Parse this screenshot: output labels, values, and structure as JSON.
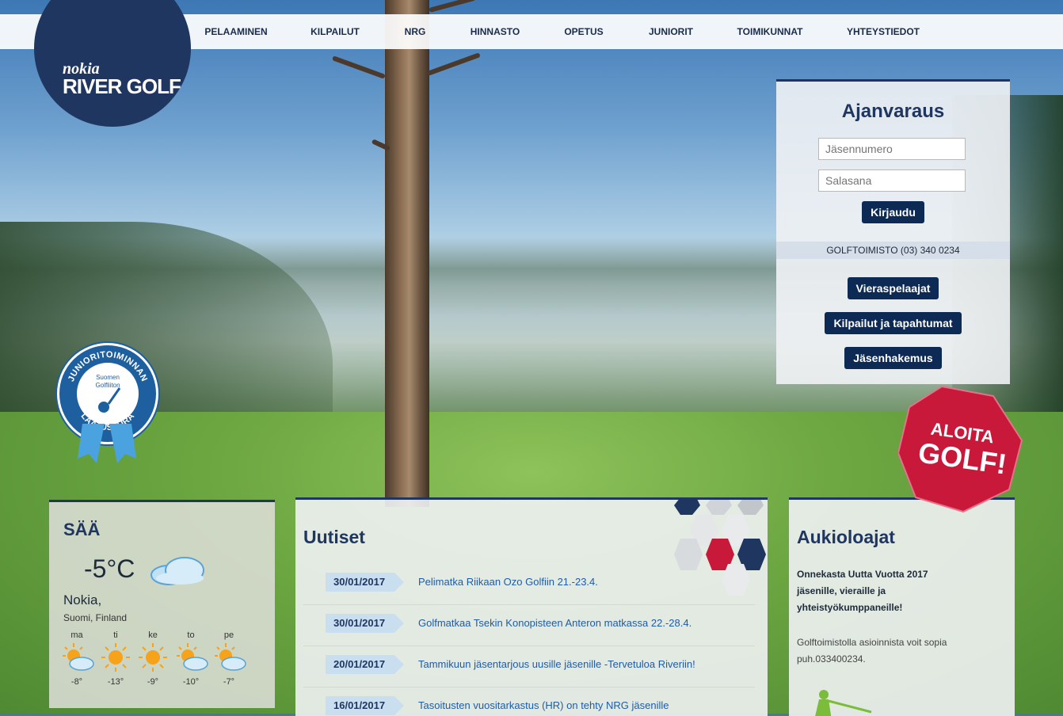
{
  "nav": {
    "items": [
      "PELAAMINEN",
      "KILPAILUT",
      "NRG",
      "HINNASTO",
      "OPETUS",
      "JUNIORIT",
      "TOIMIKUNNAT",
      "YHTEYSTIEDOT"
    ]
  },
  "logo": {
    "line1": "nokia",
    "line2": "RIVER GOLF"
  },
  "badge": {
    "text_top": "JUNIORITOIMINNAN",
    "text_center": "Suomen Golfliiton",
    "text_bottom": "LAATUSEURA"
  },
  "booking": {
    "title": "Ajanvaraus",
    "member_placeholder": "Jäsennumero",
    "password_placeholder": "Salasana",
    "login_label": "Kirjaudu",
    "phone": "GOLFTOIMISTO (03) 340 0234",
    "buttons": [
      "Vieraspelaajat",
      "Kilpailut ja tapahtumat",
      "Jäsenhakemus"
    ]
  },
  "aloita": {
    "line1": "ALOITA",
    "line2": "GOLF!"
  },
  "weather": {
    "title": "SÄÄ",
    "temp": "-5°C",
    "city": "Nokia,",
    "region": "Suomi, Finland",
    "forecast": [
      {
        "day": "ma",
        "temp": "-8°",
        "icon": "sun-cloud-icon"
      },
      {
        "day": "ti",
        "temp": "-13°",
        "icon": "sun-icon"
      },
      {
        "day": "ke",
        "temp": "-9°",
        "icon": "sun-icon"
      },
      {
        "day": "to",
        "temp": "-10°",
        "icon": "sun-cloud-icon"
      },
      {
        "day": "pe",
        "temp": "-7°",
        "icon": "sun-cloud-icon"
      }
    ]
  },
  "news": {
    "title": "Uutiset",
    "items": [
      {
        "date": "30/01/2017",
        "title": "Pelimatka Riikaan Ozo Golfiin 21.-23.4."
      },
      {
        "date": "30/01/2017",
        "title": "Golfmatkaa Tsekin Konopisteen Anteron matkassa 22.-28.4."
      },
      {
        "date": "20/01/2017",
        "title": "Tammikuun jäsentarjous uusille jäsenille -Tervetuloa Riveriin!"
      },
      {
        "date": "16/01/2017",
        "title": "Tasoitusten vuositarkastus (HR) on tehty NRG jäsenille"
      }
    ]
  },
  "hours": {
    "title": "Aukioloajat",
    "greeting": "Onnekasta Uutta Vuotta 2017 jäsenille, vieraille ja yhteistyökumppaneille!",
    "info": "Golftoimistolla asioinnista voit sopia puh.033400234."
  },
  "colors": {
    "navy": "#1f3660",
    "button": "#0c2a54",
    "accent_red": "#c8193a",
    "link": "#1f5ca8",
    "home_icon": "#7bbd3a"
  }
}
